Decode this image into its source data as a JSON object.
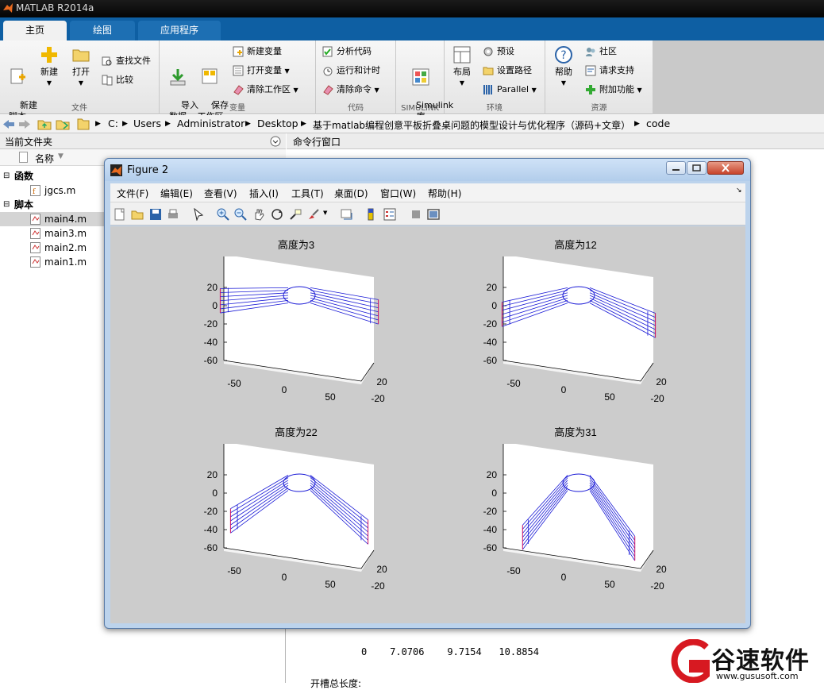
{
  "window": {
    "title": "MATLAB R2014a"
  },
  "tabs": [
    {
      "label": "主页"
    },
    {
      "label": "绘图"
    },
    {
      "label": "应用程序"
    }
  ],
  "ribbon": {
    "file": {
      "group_label": "文件",
      "new_script": "新建\n脚本",
      "new": "新建",
      "open": "打开",
      "find_files": "查找文件",
      "compare": "比较"
    },
    "variable": {
      "group_label": "变量",
      "import": "导入\n数据",
      "save_ws": "保存\n工作区",
      "new_var": "新建变量",
      "open_var": "打开变量",
      "clear_ws": "清除工作区"
    },
    "code": {
      "group_label": "代码",
      "analyze": "分析代码",
      "run_time": "运行和计时",
      "clear_cmd": "清除命令"
    },
    "simulink": {
      "group_label": "SIMULINK",
      "lib": "Simulink\n库"
    },
    "env": {
      "group_label": "环境",
      "layout": "布局",
      "prefs": "预设",
      "set_path": "设置路径",
      "parallel": "Parallel"
    },
    "resources": {
      "group_label": "资源",
      "help": "帮助",
      "community": "社区",
      "support": "请求支持",
      "addons": "附加功能"
    }
  },
  "address": {
    "parts": [
      "C:",
      "Users",
      "Administrator",
      "Desktop",
      "基于matlab编程创意平板折叠桌问题的模型设计与优化程序（源码+文章）",
      "code"
    ]
  },
  "current_folder": {
    "title": "当前文件夹",
    "col_name": "名称",
    "functions_label": "函数",
    "scripts_label": "脚本",
    "functions": [
      "jgcs.m"
    ],
    "scripts": [
      "main4.m",
      "main3.m",
      "main2.m",
      "main1.m"
    ]
  },
  "command_window": {
    "title": "命令行窗口",
    "line1": "0    7.0706    9.7154   10.8854",
    "line2": "开槽总长度:"
  },
  "figure": {
    "title": "Figure 2",
    "menus": [
      "文件(F)",
      "编辑(E)",
      "查看(V)",
      "插入(I)",
      "工具(T)",
      "桌面(D)",
      "窗口(W)",
      "帮助(H)"
    ],
    "subplots": [
      {
        "title": "高度为3"
      },
      {
        "title": "高度为12"
      },
      {
        "title": "高度为22"
      },
      {
        "title": "高度为31"
      }
    ],
    "z_ticks": [
      "20",
      "0",
      "-20",
      "-40",
      "-60"
    ],
    "x_ticks": [
      "-50",
      "0",
      "50"
    ],
    "y_ticks": [
      "20",
      "-20"
    ]
  },
  "chart_data": [
    {
      "type": "surface",
      "title": "高度为3",
      "zlim": [
        -70,
        30
      ],
      "xlim": [
        -70,
        70
      ],
      "ylim": [
        -20,
        20
      ],
      "fold_angle_deg": 5
    },
    {
      "type": "surface",
      "title": "高度为12",
      "zlim": [
        -70,
        30
      ],
      "xlim": [
        -70,
        70
      ],
      "ylim": [
        -20,
        20
      ],
      "fold_angle_deg": 15
    },
    {
      "type": "surface",
      "title": "高度为22",
      "zlim": [
        -70,
        30
      ],
      "xlim": [
        -70,
        70
      ],
      "ylim": [
        -20,
        20
      ],
      "fold_angle_deg": 30
    },
    {
      "type": "surface",
      "title": "高度为31",
      "zlim": [
        -70,
        30
      ],
      "xlim": [
        -70,
        70
      ],
      "ylim": [
        -20,
        20
      ],
      "fold_angle_deg": 45
    }
  ],
  "watermark": {
    "text": "谷速软件",
    "url": "www.gususoft.com"
  },
  "colors": {
    "tabstrip": "#0e5fa3",
    "line_blue": "#1a1ad6",
    "line_red": "#d01060"
  }
}
